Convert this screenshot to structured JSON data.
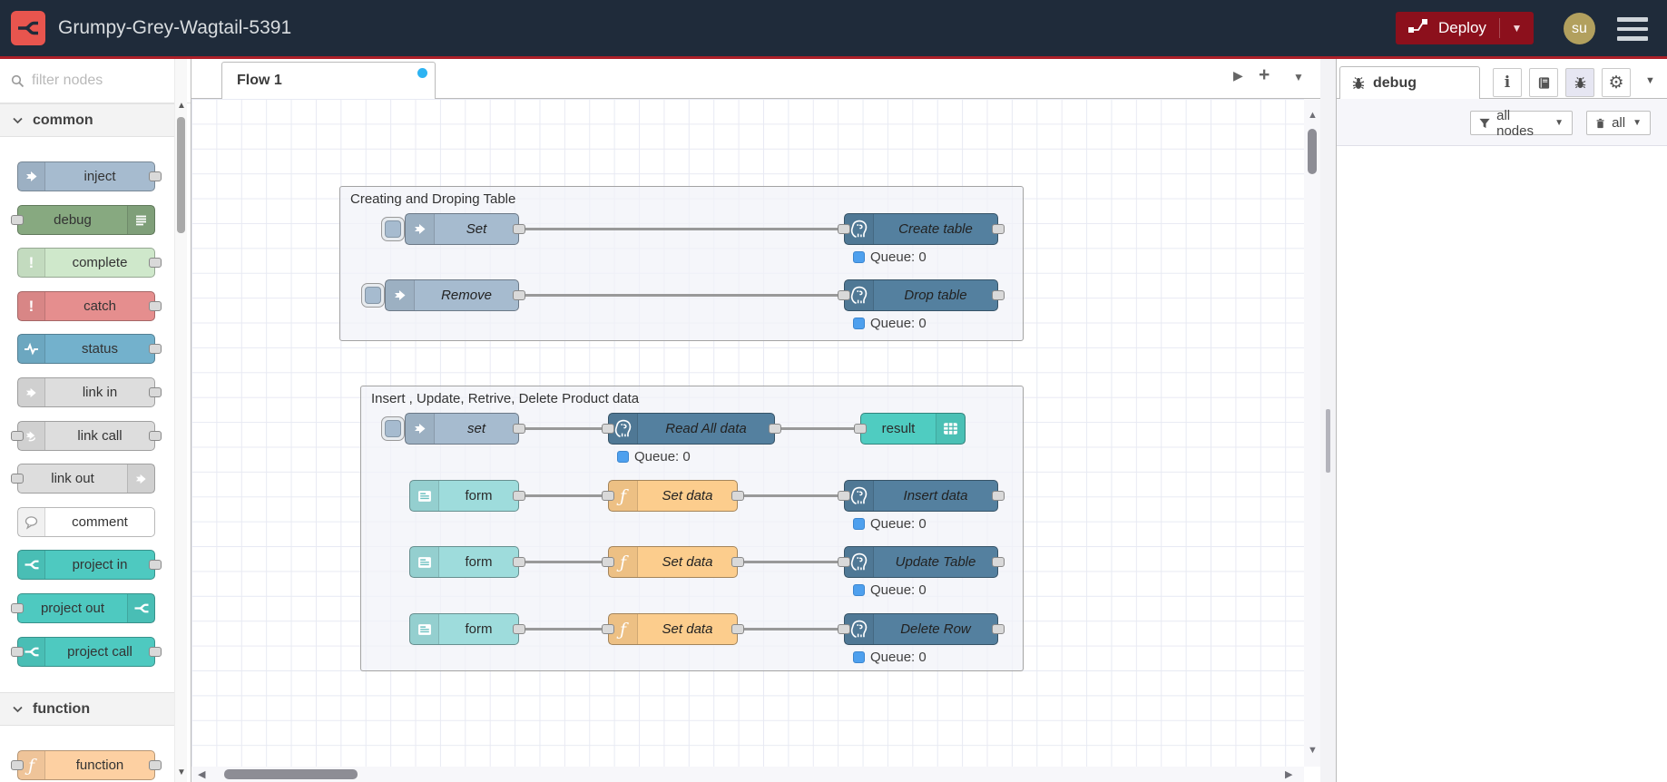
{
  "header": {
    "title": "Grumpy-Grey-Wagtail-5391",
    "deploy_label": "Deploy",
    "avatar_initials": "su"
  },
  "palette": {
    "filter_placeholder": "filter nodes",
    "categories": [
      {
        "label": "common",
        "items": [
          {
            "label": "inject"
          },
          {
            "label": "debug"
          },
          {
            "label": "complete"
          },
          {
            "label": "catch"
          },
          {
            "label": "status"
          },
          {
            "label": "link in"
          },
          {
            "label": "link call"
          },
          {
            "label": "link out"
          },
          {
            "label": "comment"
          },
          {
            "label": "project in"
          },
          {
            "label": "project out"
          },
          {
            "label": "project call"
          }
        ]
      },
      {
        "label": "function",
        "items": [
          {
            "label": "function"
          }
        ]
      }
    ]
  },
  "canvas": {
    "tab_label": "Flow 1",
    "groups": [
      {
        "title": "Creating and Droping Table"
      },
      {
        "title": "Insert , Update, Retrive, Delete Product data"
      }
    ],
    "nodes": {
      "set_upper": "Set",
      "create_table": "Create table",
      "remove": "Remove",
      "drop_table": "Drop table",
      "set_lower": "set",
      "read_all": "Read All data",
      "result": "result",
      "form": "form",
      "set_data": "Set data",
      "insert_data": "Insert data",
      "update_table": "Update Table",
      "delete_row": "Delete Row"
    },
    "queue_status": "Queue: 0"
  },
  "sidebar": {
    "tab_label": "debug",
    "filter_button_label": "all nodes",
    "clear_button_label": "all"
  },
  "colors": {
    "header_bg": "#1f2b3a",
    "accent_red": "#ad1f28",
    "logo_red": "#e8554e",
    "deploy_bg": "#8C101C",
    "avatar_bg": "#b2a05e",
    "node_inject": "#a6bbcf",
    "node_debug": "#87a980",
    "node_complete": "#cfe8cb",
    "node_catch": "#e58e8e",
    "node_status": "#73b1cc",
    "node_link": "#dddddd",
    "node_comment": "#ffffff",
    "node_project": "#4ec9c0",
    "node_function": "#fdd0a2",
    "node_form": "#9edcdc",
    "node_set_data": "#fccd8d",
    "node_result": "#4fccc1",
    "node_postgres": "#54809f",
    "queue_dot": "#4ea0ee",
    "flow_dirty_dot": "#2db3f2"
  }
}
